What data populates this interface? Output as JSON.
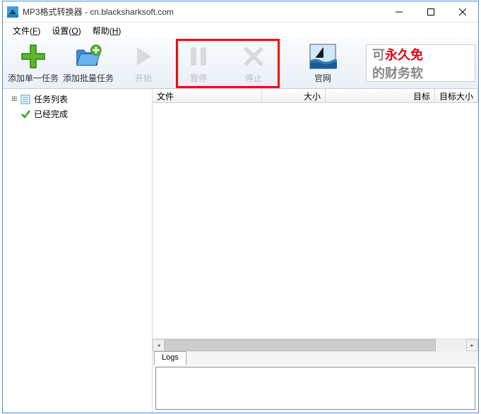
{
  "window": {
    "title": "MP3格式转换器 - cn.blacksharksoft.com"
  },
  "menubar": {
    "file": "文件",
    "file_key": "F",
    "settings": "设置",
    "settings_key": "O",
    "help": "帮助",
    "help_key": "H"
  },
  "toolbar": {
    "add_single": "添加单一任务",
    "add_batch": "添加批量任务",
    "start": "开始",
    "pause": "暂停",
    "stop": "停止",
    "website": "官网"
  },
  "ad": {
    "line1_gray": "可",
    "line1_red": "永久免",
    "line2": "的财务软"
  },
  "sidebar": {
    "items": [
      {
        "label": "任务列表"
      },
      {
        "label": "已经完成"
      }
    ]
  },
  "list": {
    "columns": {
      "file": "文件",
      "size": "大小",
      "target": "目标",
      "target_size": "目标大小"
    }
  },
  "logs": {
    "tab": "Logs"
  }
}
